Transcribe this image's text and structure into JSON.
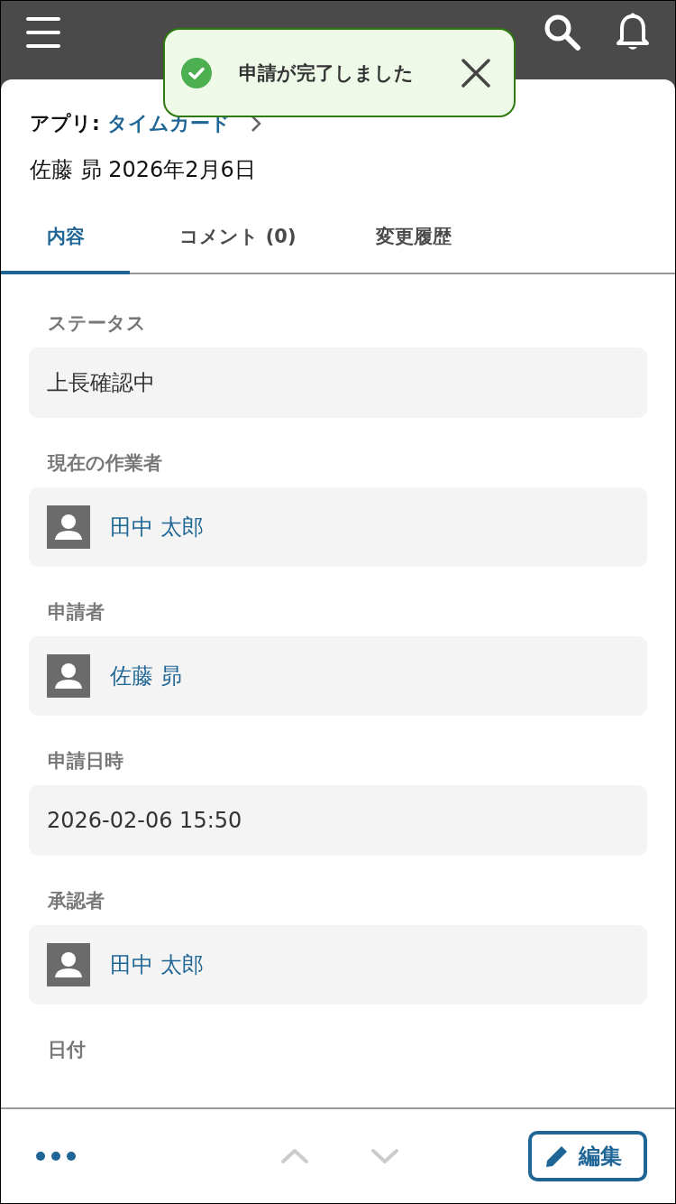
{
  "toast": {
    "message": "申請が完了しました"
  },
  "breadcrumb": {
    "label": "アプリ:",
    "app": "タイムカード"
  },
  "record_title": "佐藤 昴 2026年2月6日",
  "tabs": [
    {
      "label": "内容",
      "selected": true
    },
    {
      "label": "コメント (0)",
      "selected": false
    },
    {
      "label": "変更履歴",
      "selected": false
    }
  ],
  "fields": [
    {
      "label": "ステータス",
      "kind": "text",
      "value": "上長確認中"
    },
    {
      "label": "現在の作業者",
      "kind": "user",
      "value": "田中 太郎"
    },
    {
      "label": "申請者",
      "kind": "user",
      "value": "佐藤 昴"
    },
    {
      "label": "申請日時",
      "kind": "text",
      "value": "2026-02-06 15:50"
    },
    {
      "label": "承認者",
      "kind": "user",
      "value": "田中 太郎"
    },
    {
      "label": "日付",
      "kind": "label_only"
    }
  ],
  "footer": {
    "prev_disabled": true,
    "next_disabled": true,
    "edit_label": "編集"
  }
}
